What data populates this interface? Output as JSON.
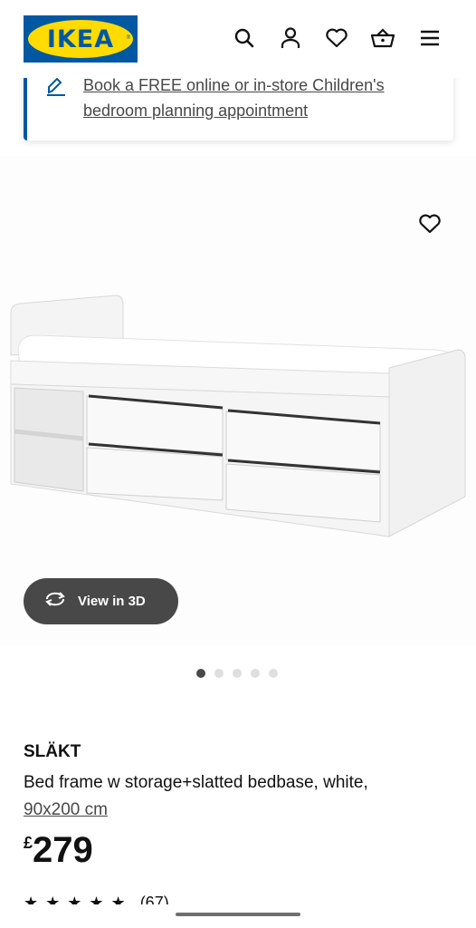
{
  "header": {
    "logo_text": "IKEA",
    "logo_reg": "®",
    "icons": [
      "search-icon",
      "account-icon",
      "heart-icon",
      "basket-icon",
      "menu-icon"
    ]
  },
  "banner": {
    "text": "Book a FREE online or in-store Children's bedroom planning appointment",
    "icon": "pencil-icon"
  },
  "gallery": {
    "view3d_label": "View in 3D",
    "dot_count": 5,
    "active_dot": 0
  },
  "product": {
    "name": "SLÄKT",
    "description": "Bed frame w storage+slatted bedbase, white,",
    "size": "90x200 cm",
    "currency": "£",
    "price": "279",
    "stars": "★★★★★",
    "review_count": "(67)"
  },
  "colors": {
    "brand_blue": "#0058a3",
    "brand_yellow": "#ffdb00",
    "button_dark": "#484848"
  }
}
